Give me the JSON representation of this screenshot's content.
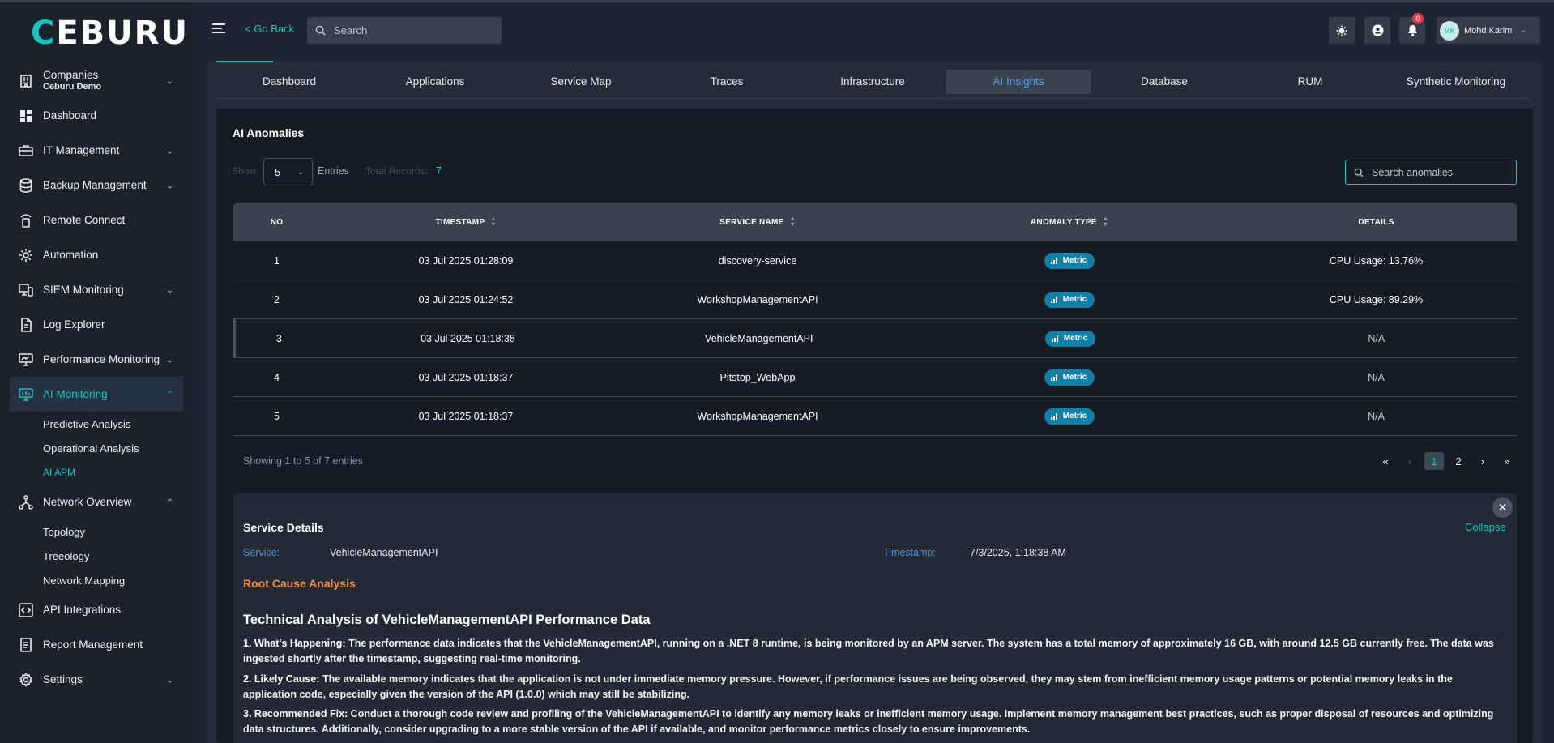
{
  "brand": {
    "name_accent": "C",
    "name_rest": "EBURU"
  },
  "topbar": {
    "go_back": "< Go Back",
    "search_placeholder": "Search",
    "notification_count": "0",
    "user_initials": "MK",
    "user_name": "Mohd Karim"
  },
  "sidebar": {
    "companies_label": "Companies",
    "companies_sub": "Ceburu Demo",
    "items": [
      {
        "label": "Dashboard"
      },
      {
        "label": "IT Management"
      },
      {
        "label": "Backup Management"
      },
      {
        "label": "Remote Connect"
      },
      {
        "label": "Automation"
      },
      {
        "label": "SIEM Monitoring"
      },
      {
        "label": "Log Explorer"
      },
      {
        "label": "Performance Monitoring"
      },
      {
        "label": "AI Monitoring"
      },
      {
        "label": "Network Overview"
      },
      {
        "label": "API Integrations"
      },
      {
        "label": "Report Management"
      },
      {
        "label": "Settings"
      }
    ],
    "ai_sub": [
      "Predictive Analysis",
      "Operational Analysis",
      "AI APM"
    ],
    "network_sub": [
      "Topology",
      "Treeology",
      "Network Mapping"
    ]
  },
  "tabs": [
    "Dashboard",
    "Applications",
    "Service Map",
    "Traces",
    "Infrastructure",
    "AI Insights",
    "Database",
    "RUM",
    "Synthetic Monitoring"
  ],
  "anomalies": {
    "title": "AI Anomalies",
    "show_label": "Show",
    "entries_value": "5",
    "entries_label": "Entries",
    "total_label": "Total Records:",
    "total_value": "7",
    "search_placeholder": "Search anomalies",
    "columns": [
      "NO",
      "TIMESTAMP",
      "SERVICE NAME",
      "ANOMALY TYPE",
      "DETAILS"
    ],
    "rows": [
      {
        "no": "1",
        "timestamp": "03 Jul 2025 01:28:09",
        "service": "discovery-service",
        "type": "Metric",
        "details": "CPU Usage: 13.76%"
      },
      {
        "no": "2",
        "timestamp": "03 Jul 2025 01:24:52",
        "service": "WorkshopManagementAPI",
        "type": "Metric",
        "details": "CPU Usage: 89.29%"
      },
      {
        "no": "3",
        "timestamp": "03 Jul 2025 01:18:38",
        "service": "VehicleManagementAPI",
        "type": "Metric",
        "details": "N/A"
      },
      {
        "no": "4",
        "timestamp": "03 Jul 2025 01:18:37",
        "service": "Pitstop_WebApp",
        "type": "Metric",
        "details": "N/A"
      },
      {
        "no": "5",
        "timestamp": "03 Jul 2025 01:18:37",
        "service": "WorkshopManagementAPI",
        "type": "Metric",
        "details": "N/A"
      }
    ],
    "showing_text": "Showing 1 to 5 of 7 entries",
    "pages": [
      "1",
      "2"
    ]
  },
  "service_details": {
    "title": "Service Details",
    "collapse": "Collapse",
    "service_label": "Service:",
    "service_value": "VehicleManagementAPI",
    "timestamp_label": "Timestamp:",
    "timestamp_value": "7/3/2025, 1:18:38 AM",
    "rca_title": "Root Cause Analysis",
    "analysis_title": "Technical Analysis of VehicleManagementAPI Performance Data",
    "p1_head": "1. What's Happening:",
    "p1_body": " The performance data indicates that the VehicleManagementAPI, running on a .NET 8 runtime, is being monitored by an APM server. The system has a total memory of approximately 16 GB, with around 12.5 GB currently free. The data was ingested shortly after the timestamp, suggesting real-time monitoring.",
    "p2_head": "2. Likely Cause:",
    "p2_body": " The available memory indicates that the application is not under immediate memory pressure. However, if performance issues are being observed, they may stem from inefficient memory usage patterns or potential memory leaks in the application code, especially given the version of the API (1.0.0) which may still be stabilizing.",
    "p3_head": "3. Recommended Fix:",
    "p3_body": " Conduct a thorough code review and profiling of the VehicleManagementAPI to identify any memory leaks or inefficient memory usage. Implement memory management best practices, such as proper disposal of resources and optimizing data structures. Additionally, consider upgrading to a more stable version of the API if available, and monitor performance metrics closely to ensure improvements."
  }
}
